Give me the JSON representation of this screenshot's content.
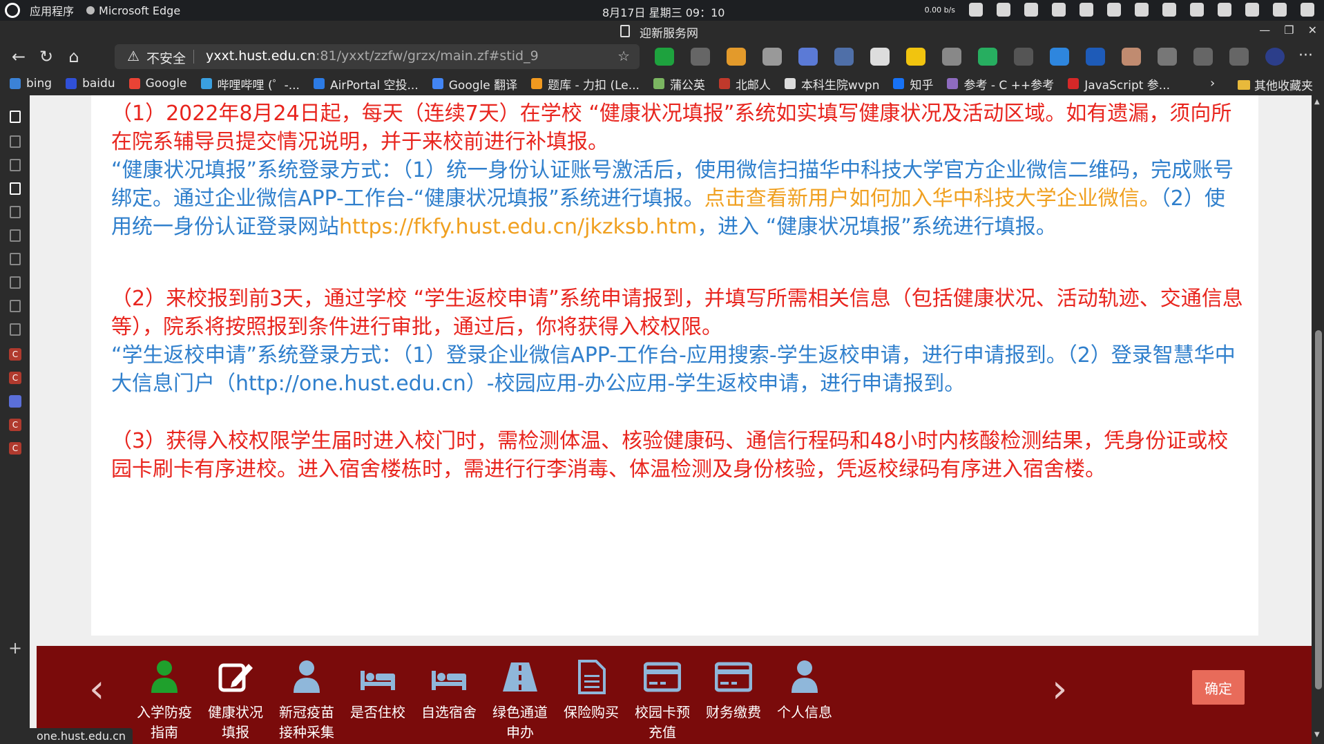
{
  "os_bar": {
    "activities": "应用程序",
    "app_name": "Microsoft Edge",
    "clock": "8月17日 星期三  09：10",
    "net_speed": "0.00 b/s"
  },
  "window": {
    "title": "迎新服务网"
  },
  "address_bar": {
    "security_label": "不安全",
    "host": "yxxt.hust.edu.cn",
    "path": ":81/yxxt/zzfw/grzx/main.zf#stid_9"
  },
  "bookmarks": [
    {
      "label": "bing",
      "color": "#3b82d6"
    },
    {
      "label": "baidu",
      "color": "#3050d8"
    },
    {
      "label": "Google",
      "color": "#ea4335"
    },
    {
      "label": "哔哩哔哩 (゜-...",
      "color": "#3aa0e0"
    },
    {
      "label": "AirPortal 空投...",
      "color": "#2c7be5"
    },
    {
      "label": "Google 翻译",
      "color": "#4285f4"
    },
    {
      "label": "题库 - 力扣 (Le...",
      "color": "#f29a1f"
    },
    {
      "label": "蒲公英",
      "color": "#7bb661"
    },
    {
      "label": "北邮人",
      "color": "#c0392b"
    },
    {
      "label": "本科生院wvpn",
      "color": "#dddddd"
    },
    {
      "label": "知乎",
      "color": "#1772f6"
    },
    {
      "label": "参考 - C ++参考",
      "color": "#8e6bbf"
    },
    {
      "label": "JavaScript 参...",
      "color": "#d62828"
    }
  ],
  "bookmarks_other": "其他收藏夹",
  "content": {
    "p1_red": "（1）2022年8月24日起，每天（连续7天）在学校 “健康状况填报”系统如实填写健康状况及活动区域。如有遗漏，须向所在院系辅导员提交情况说明，并于来校前进行补填报。",
    "p1_blue_a": "“健康状况填报”系统登录方式：（1）统一身份认证账号激活后，使用微信扫描华中科技大学官方企业微信二维码，完成账号绑定。通过企业微信APP-工作台-“健康状况填报”系统进行填报。",
    "p1_orange": "点击查看新用户如何加入华中科技大学企业微信。",
    "p1_blue_b": "（2）使用统一身份认证登录网站",
    "p1_link": "https://fkfy.hust.edu.cn/jkzksb.htm",
    "p1_blue_c": "，进入 “健康状况填报”系统进行填报。",
    "p2_red": "（2）来校报到前3天，通过学校 “学生返校申请”系统申请报到，并填写所需相关信息（包括健康状况、活动轨迹、交通信息等），院系将按照报到条件进行审批，通过后，你将获得入校权限。",
    "p2_blue": "“学生返校申请”系统登录方式：（1）登录企业微信APP-工作台-应用搜索-学生返校申请，进行申请报到。（2）登录智慧华中大信息门户（http://one.hust.edu.cn）-校园应用-办公应用-学生返校申请，进行申请报到。",
    "p3_red": "（3）获得入校权限学生届时进入校门时，需检测体温、核验健康码、通信行程码和48小时内核酸检测结果，凭身份证或校园卡刷卡有序进校。进入宿舍楼栋时，需进行行李消毒、体温检测及身份核验，凭返校绿码有序进入宿舍楼。"
  },
  "bottom_nav": {
    "items": [
      {
        "line1": "入学防疫",
        "line2": "指南",
        "icon": "person-icon",
        "color": "#1fa02c"
      },
      {
        "line1": "健康状况",
        "line2": "填报",
        "icon": "edit-icon",
        "color": "#ffffff"
      },
      {
        "line1": "新冠疫苗",
        "line2": "接种采集",
        "icon": "person-icon",
        "color": "#8fb7da"
      },
      {
        "line1": "是否住校",
        "line2": "",
        "icon": "bed-icon",
        "color": "#8fb7da"
      },
      {
        "line1": "自选宿舍",
        "line2": "",
        "icon": "bed-icon",
        "color": "#8fb7da"
      },
      {
        "line1": "绿色通道",
        "line2": "申办",
        "icon": "road-icon",
        "color": "#8fb7da"
      },
      {
        "line1": "保险购买",
        "line2": "",
        "icon": "document-icon",
        "color": "#8fb7da"
      },
      {
        "line1": "校园卡预",
        "line2": "充值",
        "icon": "card-icon",
        "color": "#8fb7da"
      },
      {
        "line1": "财务缴费",
        "line2": "",
        "icon": "card-icon",
        "color": "#8fb7da"
      },
      {
        "line1": "个人信息",
        "line2": "",
        "icon": "person-icon",
        "color": "#8fb7da"
      }
    ],
    "confirm_label": "确定"
  },
  "status_url": "one.hust.edu.cn"
}
